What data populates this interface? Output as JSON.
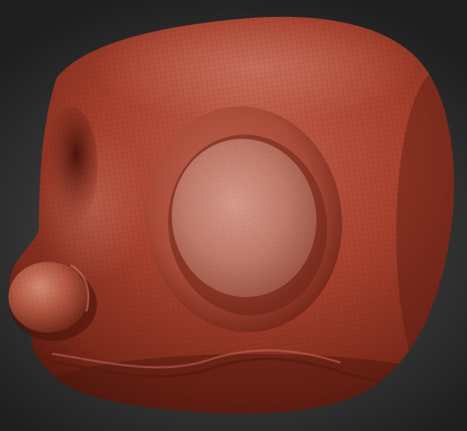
{
  "viewport": {
    "background_color": "#3c3c3c"
  },
  "model": {
    "subject": "sculpted-creature-head",
    "material_color": "#a8412e",
    "highlight_color": "#d9907f",
    "shadow_color": "#5a1a10",
    "wireframe_visible": true
  }
}
